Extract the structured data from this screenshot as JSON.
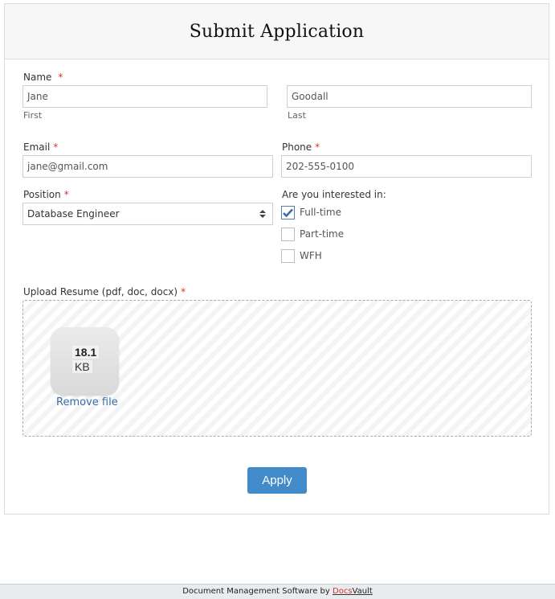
{
  "form": {
    "title": "Submit Application",
    "name": {
      "label": "Name",
      "required_mark": "*",
      "first": {
        "value": "Jane",
        "sublabel": "First"
      },
      "last": {
        "value": "Goodall",
        "sublabel": "Last"
      }
    },
    "email": {
      "label": "Email",
      "required_mark": "*",
      "value": "jane@gmail.com"
    },
    "phone": {
      "label": "Phone",
      "required_mark": "*",
      "value": "202-555-0100"
    },
    "position": {
      "label": "Position",
      "required_mark": "*",
      "selected": "Database Engineer",
      "icon": "sort-arrows-icon"
    },
    "interests": {
      "label": "Are you interested in:",
      "options": [
        {
          "label": "Full-time",
          "checked": true
        },
        {
          "label": "Part-time",
          "checked": false
        },
        {
          "label": "WFH",
          "checked": false
        }
      ]
    },
    "upload": {
      "label": "Upload Resume (pdf, doc, docx)",
      "required_mark": "*",
      "file": {
        "size_value": "18.1",
        "size_unit": "KB",
        "remove_label": "Remove file"
      }
    },
    "submit_label": "Apply"
  },
  "footer": {
    "text": "Document Management Software by",
    "brand_part1": "Docs",
    "brand_part2": "Vault"
  },
  "colors": {
    "accent": "#428bca",
    "required": "#d9322b",
    "link": "#3b6ea3",
    "header_bg": "#f7f7f7"
  }
}
